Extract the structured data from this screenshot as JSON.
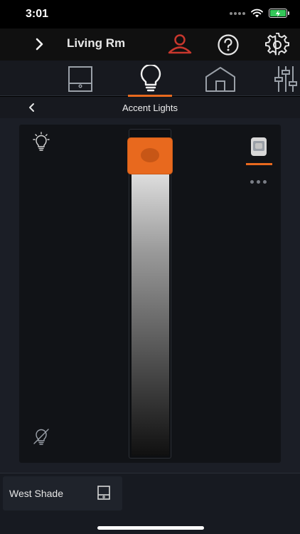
{
  "status_bar": {
    "time": "3:01"
  },
  "header": {
    "room_title": "Living Rm"
  },
  "tabs": [
    {
      "name": "shades",
      "icon": "window-shade-icon"
    },
    {
      "name": "lights",
      "icon": "lightbulb-icon",
      "selected": true
    },
    {
      "name": "home",
      "icon": "house-icon"
    },
    {
      "name": "settings",
      "icon": "sliders-icon"
    }
  ],
  "subheader": {
    "title": "Accent Lights"
  },
  "dimmer": {
    "level_fraction": 1.0
  },
  "bottom": {
    "shade_label": "West Shade"
  },
  "colors": {
    "accent": "#e8691e",
    "user_icon": "#c8372d",
    "background": "#1b1e26",
    "panel": "#111317"
  }
}
